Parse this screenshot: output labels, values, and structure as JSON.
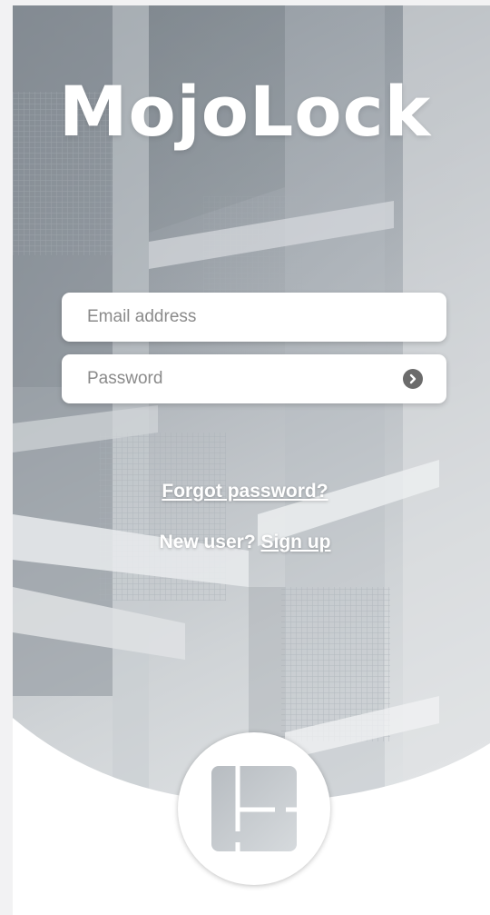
{
  "app": {
    "logo_text": "MojoLock"
  },
  "login": {
    "email_placeholder": "Email address",
    "email_value": "",
    "password_placeholder": "Password",
    "password_value": "",
    "submit_icon": "chevron-right-circle-icon"
  },
  "links": {
    "forgot_password": "Forgot password?",
    "new_user_prefix": "New user?",
    "sign_up": "Sign up"
  },
  "footer": {
    "badge_icon": "floorplan-icon"
  },
  "colors": {
    "text_on_hero": "#ffffff",
    "field_bg": "#ffffff",
    "placeholder": "#8a8a8a",
    "submit_icon_bg": "#6b6b6b",
    "sidebar_strip": "#f2f2f3"
  }
}
